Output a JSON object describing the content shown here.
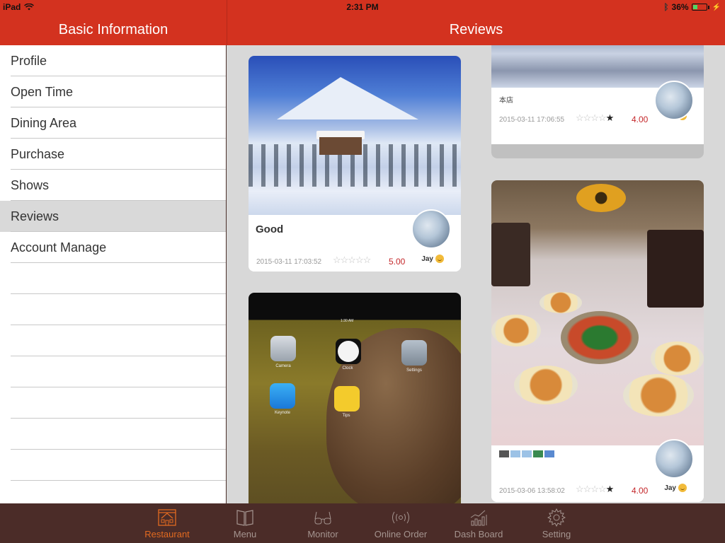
{
  "status_bar": {
    "device": "iPad",
    "time": "2:31 PM",
    "battery_percent": "36%",
    "battery_level": 0.36
  },
  "header": {
    "left_title": "Basic Information",
    "right_title": "Reviews"
  },
  "sidebar": {
    "items": [
      {
        "label": "Profile"
      },
      {
        "label": "Open Time"
      },
      {
        "label": "Dining Area"
      },
      {
        "label": "Purchase"
      },
      {
        "label": "Shows"
      },
      {
        "label": "Reviews",
        "active": true
      },
      {
        "label": "Account Manage"
      }
    ]
  },
  "reviews": [
    {
      "title": "Good",
      "date": "2015-03-11 17:03:52",
      "stars": 5,
      "stars_text": "☆☆☆☆☆",
      "rating": "5.00",
      "user": "Jay",
      "photo": "snowy-mountain-cabin"
    },
    {
      "title": "",
      "date": "",
      "stars": 0,
      "rating": "",
      "user": "",
      "photo": "ipad-home-screen-squirrel",
      "photo_labels": {
        "time": "1:30 AM",
        "camera": "Camera",
        "clock": "Clock",
        "settings": "Settings",
        "keynote": "Keynote",
        "tips": "Tips"
      }
    },
    {
      "title": "",
      "date": "2015-03-11 17:06:55",
      "stars": 4,
      "stars_text_off": "☆☆☆☆",
      "stars_text_on": "★",
      "rating": "4.00",
      "user": "Jay",
      "photo": "snow-landscape"
    },
    {
      "title": "",
      "date": "2015-03-06 13:58:02",
      "stars": 4,
      "stars_text_off": "☆☆☆☆",
      "stars_text_on": "★",
      "rating": "4.00",
      "user": "Jay",
      "photo": "dinner-table"
    }
  ],
  "tabbar": {
    "items": [
      {
        "label": "Restaurant",
        "icon": "restaurant-icon",
        "active": true
      },
      {
        "label": "Menu",
        "icon": "menu-book-icon"
      },
      {
        "label": "Monitor",
        "icon": "glasses-icon"
      },
      {
        "label": "Online Order",
        "icon": "broadcast-icon"
      },
      {
        "label": "Dash Board",
        "icon": "chart-icon"
      },
      {
        "label": "Setting",
        "icon": "gear-icon"
      }
    ]
  },
  "colors": {
    "header_red": "#d3321f",
    "tabbar_brown": "#4b2c28",
    "tab_active": "#e26a20",
    "rating_red": "#c4272a",
    "selected_row": "#d9d9d9"
  }
}
